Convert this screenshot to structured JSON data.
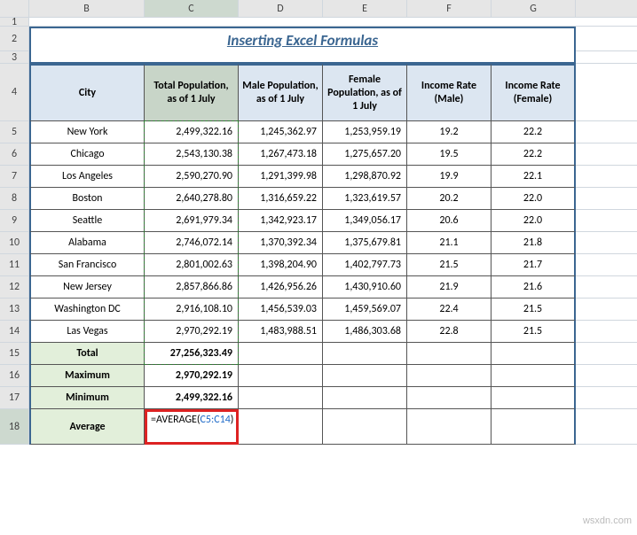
{
  "columns": [
    "",
    "B",
    "C",
    "D",
    "E",
    "F",
    "G",
    ""
  ],
  "rows": [
    "1",
    "2",
    "3",
    "4",
    "5",
    "6",
    "7",
    "8",
    "9",
    "10",
    "11",
    "12",
    "13",
    "14",
    "15",
    "16",
    "17",
    "18"
  ],
  "title": "Inserting Excel Formulas",
  "headers": {
    "city": "City",
    "total": "Total Population, as of 1 July",
    "male": "Male Population, as of 1 July",
    "female": "Female Population, as of 1 July",
    "inc_m": "Income Rate (Male)",
    "inc_f": "Income Rate (Female)"
  },
  "data": [
    {
      "city": "New York",
      "total": "2,499,322.16",
      "male": "1,245,362.97",
      "female": "1,253,959.19",
      "inc_m": "19.2",
      "inc_f": "22.2"
    },
    {
      "city": "Chicago",
      "total": "2,543,130.38",
      "male": "1,267,473.18",
      "female": "1,275,657.20",
      "inc_m": "19.5",
      "inc_f": "22.2"
    },
    {
      "city": "Los Angeles",
      "total": "2,590,270.90",
      "male": "1,291,399.98",
      "female": "1,298,870.92",
      "inc_m": "19.9",
      "inc_f": "22.1"
    },
    {
      "city": "Boston",
      "total": "2,640,278.80",
      "male": "1,316,659.22",
      "female": "1,323,619.57",
      "inc_m": "20.2",
      "inc_f": "22.0"
    },
    {
      "city": "Seattle",
      "total": "2,691,979.34",
      "male": "1,342,923.17",
      "female": "1,349,056.17",
      "inc_m": "20.6",
      "inc_f": "22.0"
    },
    {
      "city": "Alabama",
      "total": "2,746,072.14",
      "male": "1,370,392.34",
      "female": "1,375,679.81",
      "inc_m": "21.1",
      "inc_f": "21.8"
    },
    {
      "city": "San Francisco",
      "total": "2,801,002.63",
      "male": "1,398,204.90",
      "female": "1,402,797.73",
      "inc_m": "21.5",
      "inc_f": "21.7"
    },
    {
      "city": "New Jersey",
      "total": "2,857,866.86",
      "male": "1,426,956.26",
      "female": "1,430,910.60",
      "inc_m": "21.9",
      "inc_f": "21.6"
    },
    {
      "city": "Washington DC",
      "total": "2,916,108.10",
      "male": "1,456,539.03",
      "female": "1,459,569.07",
      "inc_m": "22.4",
      "inc_f": "21.5"
    },
    {
      "city": "Las Vegas",
      "total": "2,970,292.19",
      "male": "1,483,988.51",
      "female": "1,486,303.68",
      "inc_m": "22.8",
      "inc_f": "21.5"
    }
  ],
  "summary": {
    "total_label": "Total",
    "total": "27,256,323.49",
    "max_label": "Maximum",
    "max": "2,970,292.19",
    "min_label": "Minimum",
    "min": "2,499,322.16",
    "avg_label": "Average"
  },
  "formula": {
    "func": "=AVERAGE(",
    "ref": "C5:C14",
    "close": ")"
  },
  "watermark": "wsxdn.com",
  "chart_data": {
    "type": "table",
    "title": "Inserting Excel Formulas",
    "columns": [
      "City",
      "Total Population, as of 1 July",
      "Male Population, as of 1 July",
      "Female Population, as of 1 July",
      "Income Rate (Male)",
      "Income Rate (Female)"
    ],
    "rows": [
      [
        "New York",
        2499322.16,
        1245362.97,
        1253959.19,
        19.2,
        22.2
      ],
      [
        "Chicago",
        2543130.38,
        1267473.18,
        1275657.2,
        19.5,
        22.2
      ],
      [
        "Los Angeles",
        2590270.9,
        1291399.98,
        1298870.92,
        19.9,
        22.1
      ],
      [
        "Boston",
        2640278.8,
        1316659.22,
        1323619.57,
        20.2,
        22.0
      ],
      [
        "Seattle",
        2691979.34,
        1342923.17,
        1349056.17,
        20.6,
        22.0
      ],
      [
        "Alabama",
        2746072.14,
        1370392.34,
        1375679.81,
        21.1,
        21.8
      ],
      [
        "San Francisco",
        2801002.63,
        1398204.9,
        1402797.73,
        21.5,
        21.7
      ],
      [
        "New Jersey",
        2857866.86,
        1426956.26,
        1430910.6,
        21.9,
        21.6
      ],
      [
        "Washington DC",
        2916108.1,
        1456539.03,
        1459569.07,
        22.4,
        21.5
      ],
      [
        "Las Vegas",
        2970292.19,
        1483988.51,
        1486303.68,
        22.8,
        21.5
      ]
    ],
    "summary": {
      "Total": 27256323.49,
      "Maximum": 2970292.19,
      "Minimum": 2499322.16,
      "Average_formula": "=AVERAGE(C5:C14)"
    }
  }
}
